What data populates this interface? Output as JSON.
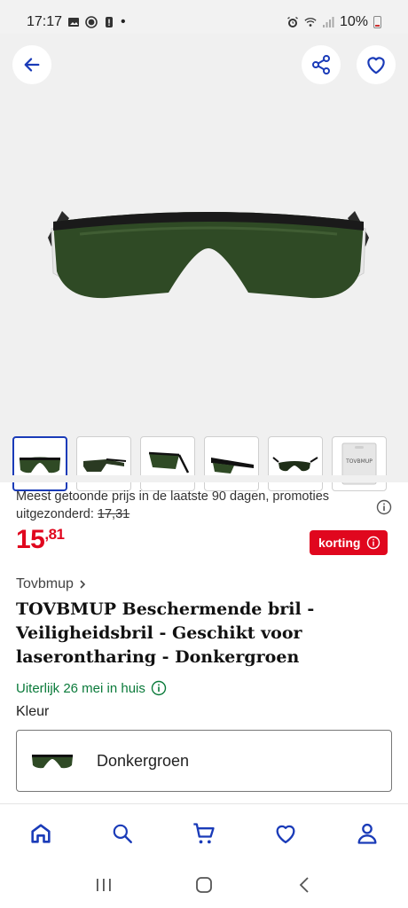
{
  "status_bar": {
    "time": "17:17",
    "dot": "•",
    "battery": "10%"
  },
  "hero": {
    "back_icon": "arrow-left-icon",
    "share_icon": "share-icon",
    "favorite_icon": "heart-icon",
    "thumbnails": [
      {
        "active": true
      },
      {
        "active": false
      },
      {
        "active": false
      },
      {
        "active": false
      },
      {
        "active": false
      },
      {
        "active": false
      }
    ]
  },
  "pricing": {
    "note": "Meest getoonde prijs in de laatste 90 dagen, promoties uitgezonderd:",
    "old_price": "17,31",
    "price_main": "15",
    "price_cents": ",81",
    "badge_label": "korting"
  },
  "product": {
    "brand": "Tovbmup",
    "title": "TOVBMUP Beschermende bril - Veiligheidsbril - Geschikt voor laserontharing - Donkergroen",
    "delivery": "Uiterlijk 26 mei in huis",
    "color_label": "Kleur",
    "selected_color": "Donkergroen"
  },
  "bottom_nav": {
    "items": [
      "home-icon",
      "search-icon",
      "cart-icon",
      "heart-icon",
      "user-icon"
    ]
  },
  "thumb_package_text": "TOVBMUP",
  "colors": {
    "accent": "#1a3bb8",
    "price_red": "#e0071e",
    "delivery_green": "#0a7a3a"
  }
}
